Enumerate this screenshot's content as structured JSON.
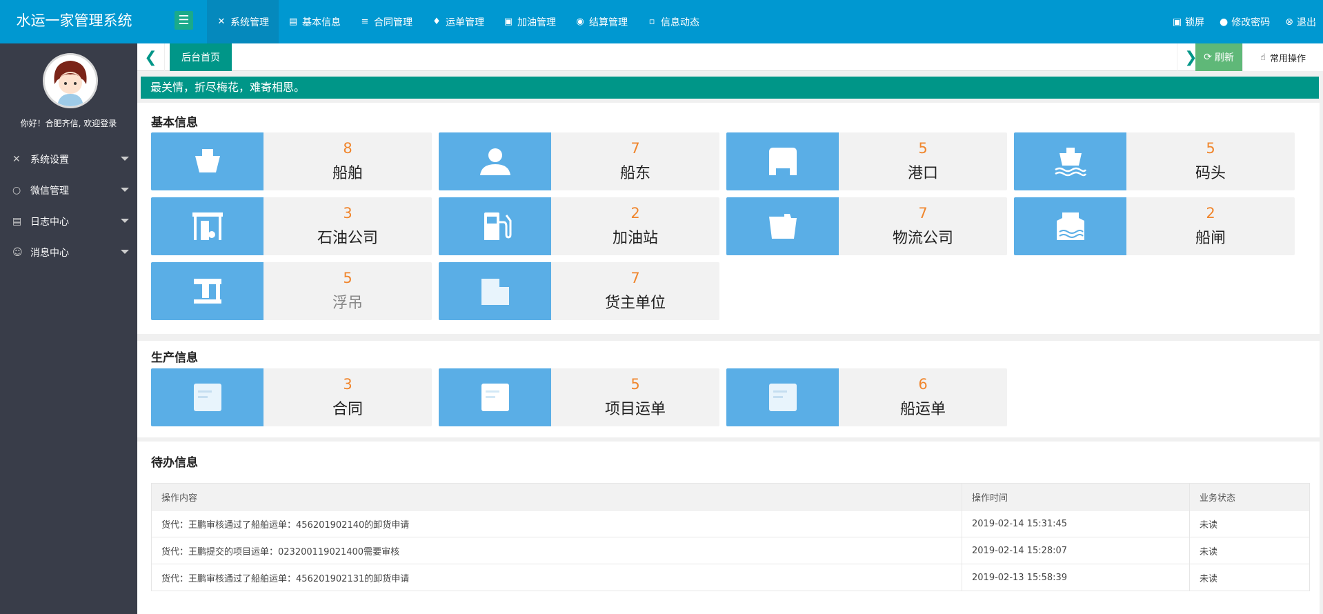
{
  "header": {
    "brand": "水运一家管理系统",
    "nav": [
      {
        "label": "系统管理",
        "icon": "wrench-icon"
      },
      {
        "label": "基本信息",
        "icon": "document-icon"
      },
      {
        "label": "合同管理",
        "icon": "list-icon"
      },
      {
        "label": "运单管理",
        "icon": "tag-icon"
      },
      {
        "label": "加油管理",
        "icon": "fuel-icon"
      },
      {
        "label": "结算管理",
        "icon": "database-icon"
      },
      {
        "label": "信息动态",
        "icon": "chat-icon"
      }
    ],
    "right": {
      "lock": "锁屏",
      "password": "修改密码",
      "logout": "退出"
    }
  },
  "sidebar": {
    "greeting": "你好！合肥齐信, 欢迎登录",
    "items": [
      {
        "label": "系统设置"
      },
      {
        "label": "微信管理"
      },
      {
        "label": "日志中心"
      },
      {
        "label": "消息中心"
      }
    ]
  },
  "tabs": {
    "home": "后台首页",
    "refresh": "刷新",
    "ops": "常用操作"
  },
  "notice": "最关情，折尽梅花，难寄相思。",
  "basic": {
    "title": "基本信息",
    "cards": [
      {
        "num": "8",
        "label": "船舶",
        "icon": "ship-icon"
      },
      {
        "num": "7",
        "label": "船东",
        "icon": "user-icon"
      },
      {
        "num": "5",
        "label": "港口",
        "icon": "port-icon"
      },
      {
        "num": "5",
        "label": "码头",
        "icon": "dock-icon"
      },
      {
        "num": "3",
        "label": "石油公司",
        "icon": "oil-station-icon"
      },
      {
        "num": "2",
        "label": "加油站",
        "icon": "gas-pump-icon"
      },
      {
        "num": "7",
        "label": "物流公司",
        "icon": "truck-icon"
      },
      {
        "num": "2",
        "label": "船闸",
        "icon": "lock-gate-icon"
      },
      {
        "num": "5",
        "label": "浮吊",
        "icon": "crane-icon"
      },
      {
        "num": "7",
        "label": "货主单位",
        "icon": "building-icon"
      }
    ]
  },
  "production": {
    "title": "生产信息",
    "cards": [
      {
        "num": "3",
        "label": "合同",
        "icon": "contract-icon"
      },
      {
        "num": "5",
        "label": "项目运单",
        "icon": "waybill-icon"
      },
      {
        "num": "6",
        "label": "船运单",
        "icon": "ship-waybill-icon"
      }
    ]
  },
  "todo": {
    "title": "待办信息",
    "columns": [
      "操作内容",
      "操作时间",
      "业务状态"
    ],
    "rows": [
      [
        "货代：王鹏审核通过了船舶运单：456201902140的卸货申请",
        "2019-02-14 15:31:45",
        "未读"
      ],
      [
        "货代：王鹏提交的项目运单：023200119021400需要审核",
        "2019-02-14 15:28:07",
        "未读"
      ],
      [
        "货代：王鹏审核通过了船舶运单：456201902131的卸货申请",
        "2019-02-13 15:58:39",
        "未读"
      ]
    ]
  }
}
